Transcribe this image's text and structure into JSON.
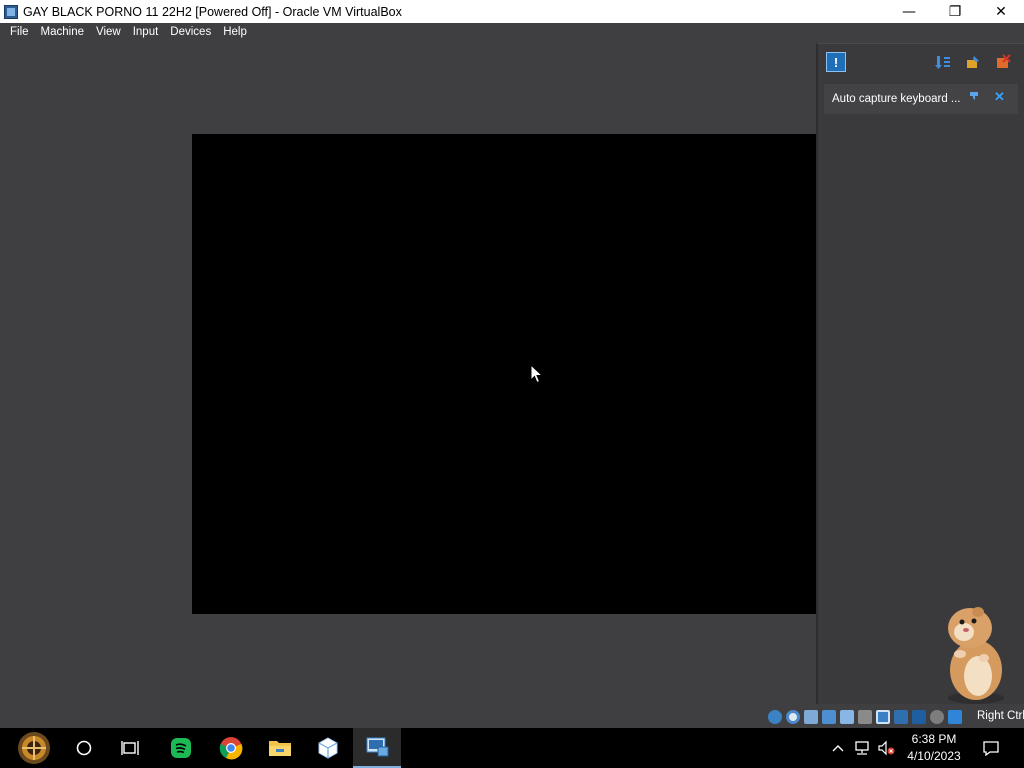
{
  "window": {
    "title": "GAY BLACK PORNO 11 22H2 [Powered Off] - Oracle VM VirtualBox",
    "controls": {
      "minimize": "—",
      "maximize": "❐",
      "close": "✕"
    }
  },
  "menu": {
    "items": [
      "File",
      "Machine",
      "View",
      "Input",
      "Devices",
      "Help"
    ]
  },
  "notification_center": {
    "toolbar_icons": [
      "info-icon",
      "sort-icon",
      "pin-icon",
      "close-all-icon"
    ],
    "items": [
      {
        "text": "Auto capture keyboard ..."
      }
    ]
  },
  "statusbar": {
    "host_key": "Right Ctrl",
    "icons": [
      "hard-disk-icon",
      "optical-drive-icon",
      "audio-icon",
      "network-icon",
      "usb-icon",
      "shared-folders-icon",
      "display-icon",
      "recording-icon",
      "vt-x-icon",
      "mouse-integration-icon",
      "keyboard-capture-icon"
    ]
  },
  "taskbar": {
    "apps": [
      "start-icon",
      "search-icon",
      "task-view-icon",
      "spotify-icon",
      "chrome-icon",
      "file-explorer-icon",
      "virtualbox-icon",
      "vm-window-icon"
    ],
    "clock": {
      "time": "6:38 PM",
      "date": "4/10/2023"
    }
  }
}
